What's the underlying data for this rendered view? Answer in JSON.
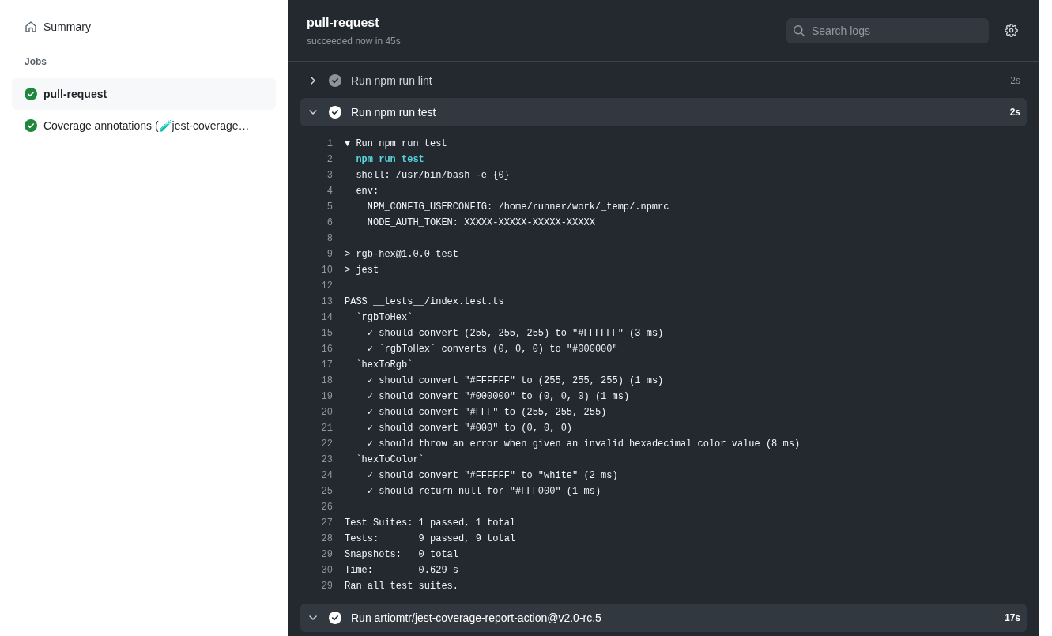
{
  "sidebar": {
    "summary": "Summary",
    "jobs_heading": "Jobs",
    "jobs": [
      {
        "label": "pull-request",
        "selected": true
      },
      {
        "label": "Coverage annotations (🧪jest-coverage…",
        "selected": false
      }
    ]
  },
  "header": {
    "title": "pull-request",
    "subtitle": "succeeded now in 45s",
    "search": {
      "placeholder": "Search logs"
    }
  },
  "steps": [
    {
      "name": "Run npm run lint",
      "duration": "2s",
      "expanded": false
    },
    {
      "name": "Run npm run test",
      "duration": "2s",
      "expanded": true,
      "log": [
        {
          "number": "1",
          "text": "▼ Run npm run test",
          "kind": "plain"
        },
        {
          "number": "2",
          "text": "  npm run test",
          "kind": "command"
        },
        {
          "number": "3",
          "text": "  shell: /usr/bin/bash -e {0}",
          "kind": "plain"
        },
        {
          "number": "4",
          "text": "  env:",
          "kind": "plain"
        },
        {
          "number": "5",
          "text": "    NPM_CONFIG_USERCONFIG: /home/runner/work/_temp/.npmrc",
          "kind": "plain"
        },
        {
          "number": "6",
          "text": "    NODE_AUTH_TOKEN: XXXXX-XXXXX-XXXXX-XXXXX",
          "kind": "plain"
        },
        {
          "number": "8"
        },
        {
          "number": "9",
          "text": "> rgb-hex@1.0.0 test",
          "kind": "plain"
        },
        {
          "number": "10",
          "text": "> jest",
          "kind": "plain"
        },
        {
          "number": "12"
        },
        {
          "number": "13",
          "text": "PASS __tests__/index.test.ts",
          "kind": "plain"
        },
        {
          "number": "14",
          "text": "  `rgbToHex`",
          "kind": "plain"
        },
        {
          "number": "15",
          "text": "    ✓ should convert (255, 255, 255) to \"#FFFFFF\" (3 ms)",
          "kind": "plain"
        },
        {
          "number": "16",
          "text": "    ✓ `rgbToHex` converts (0, 0, 0) to \"#000000\"",
          "kind": "plain"
        },
        {
          "number": "17",
          "text": "  `hexToRgb`",
          "kind": "plain"
        },
        {
          "number": "18",
          "text": "    ✓ should convert \"#FFFFFF\" to (255, 255, 255) (1 ms)",
          "kind": "plain"
        },
        {
          "number": "19",
          "text": "    ✓ should convert \"#000000\" to (0, 0, 0) (1 ms)",
          "kind": "plain"
        },
        {
          "number": "20",
          "text": "    ✓ should convert \"#FFF\" to (255, 255, 255)",
          "kind": "plain"
        },
        {
          "number": "21",
          "text": "    ✓ should convert \"#000\" to (0, 0, 0)",
          "kind": "plain"
        },
        {
          "number": "22",
          "text": "    ✓ should throw an error when given an invalid hexadecimal color value (8 ms)",
          "kind": "plain"
        },
        {
          "number": "23",
          "text": "  `hexToColor`",
          "kind": "plain"
        },
        {
          "number": "24",
          "text": "    ✓ should convert \"#FFFFFF\" to \"white\" (2 ms)",
          "kind": "plain"
        },
        {
          "number": "25",
          "text": "    ✓ should return null for \"#FFF000\" (1 ms)",
          "kind": "plain"
        },
        {
          "number": "26"
        },
        {
          "number": "27",
          "text": "Test Suites: 1 passed, 1 total",
          "kind": "plain"
        },
        {
          "number": "28",
          "text": "Tests:       9 passed, 9 total",
          "kind": "plain"
        },
        {
          "number": "29",
          "text": "Snapshots:   0 total",
          "kind": "plain"
        },
        {
          "number": "30",
          "text": "Time:        0.629 s",
          "kind": "plain"
        },
        {
          "number": "29",
          "text": "Ran all test suites.",
          "kind": "plain"
        }
      ]
    },
    {
      "name": "Run artiomtr/jest-coverage-report-action@v2.0-rc.5",
      "duration": "17s",
      "expanded": true
    }
  ]
}
